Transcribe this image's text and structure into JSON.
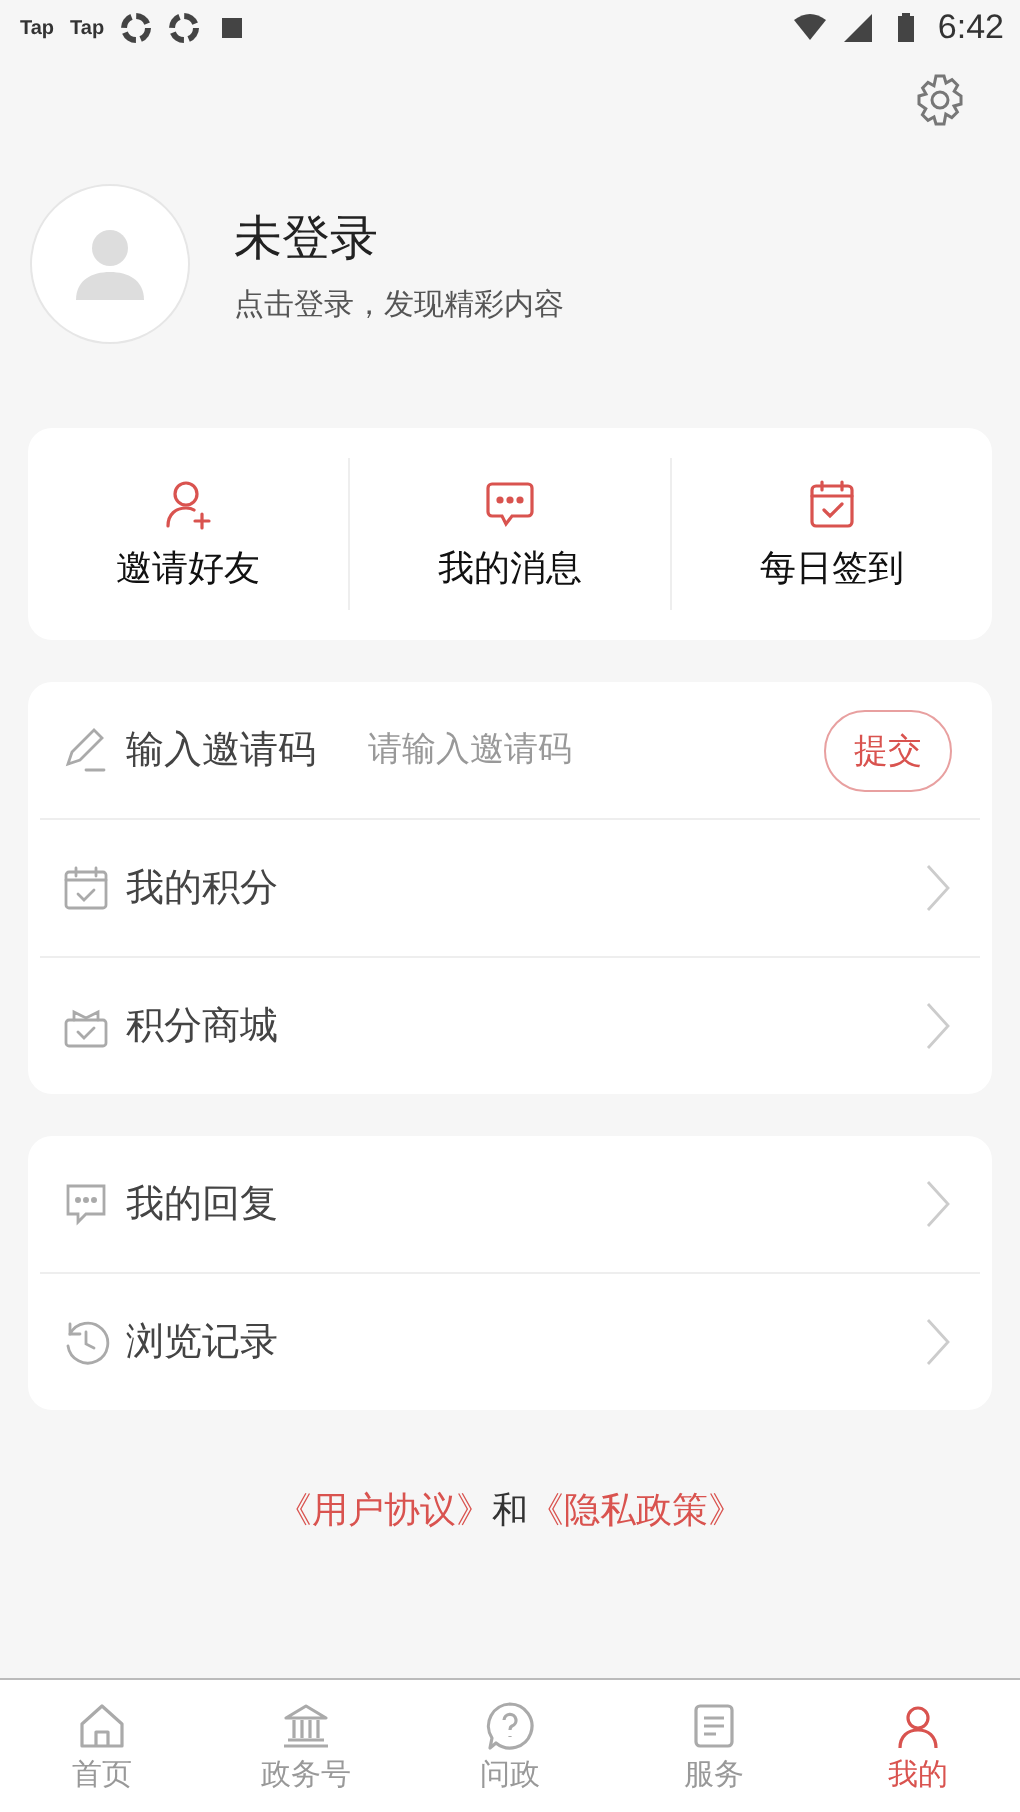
{
  "status_bar": {
    "apps": [
      "Tap",
      "Tap"
    ],
    "time": "6:42"
  },
  "profile": {
    "name": "未登录",
    "subtitle": "点击登录，发现精彩内容"
  },
  "quick_actions": [
    {
      "kind": "invite",
      "label": "邀请好友"
    },
    {
      "kind": "message",
      "label": "我的消息"
    },
    {
      "kind": "checkin",
      "label": "每日签到"
    }
  ],
  "invite_code": {
    "label": "输入邀请码",
    "placeholder": "请输入邀请码",
    "button": "提交"
  },
  "menu_group_1": [
    {
      "kind": "points",
      "label": "我的积分"
    },
    {
      "kind": "shop",
      "label": "积分商城"
    }
  ],
  "menu_group_2": [
    {
      "kind": "reply",
      "label": "我的回复"
    },
    {
      "kind": "history",
      "label": "浏览记录"
    }
  ],
  "agreement": {
    "user_agreement": "《用户协议》",
    "conjunction": "和",
    "privacy_policy": "《隐私政策》"
  },
  "bottom_nav": [
    {
      "kind": "home",
      "label": "首页",
      "selected": false
    },
    {
      "kind": "gov",
      "label": "政务号",
      "selected": false
    },
    {
      "kind": "ask",
      "label": "问政",
      "selected": false
    },
    {
      "kind": "service",
      "label": "服务",
      "selected": false
    },
    {
      "kind": "me",
      "label": "我的",
      "selected": true
    }
  ]
}
